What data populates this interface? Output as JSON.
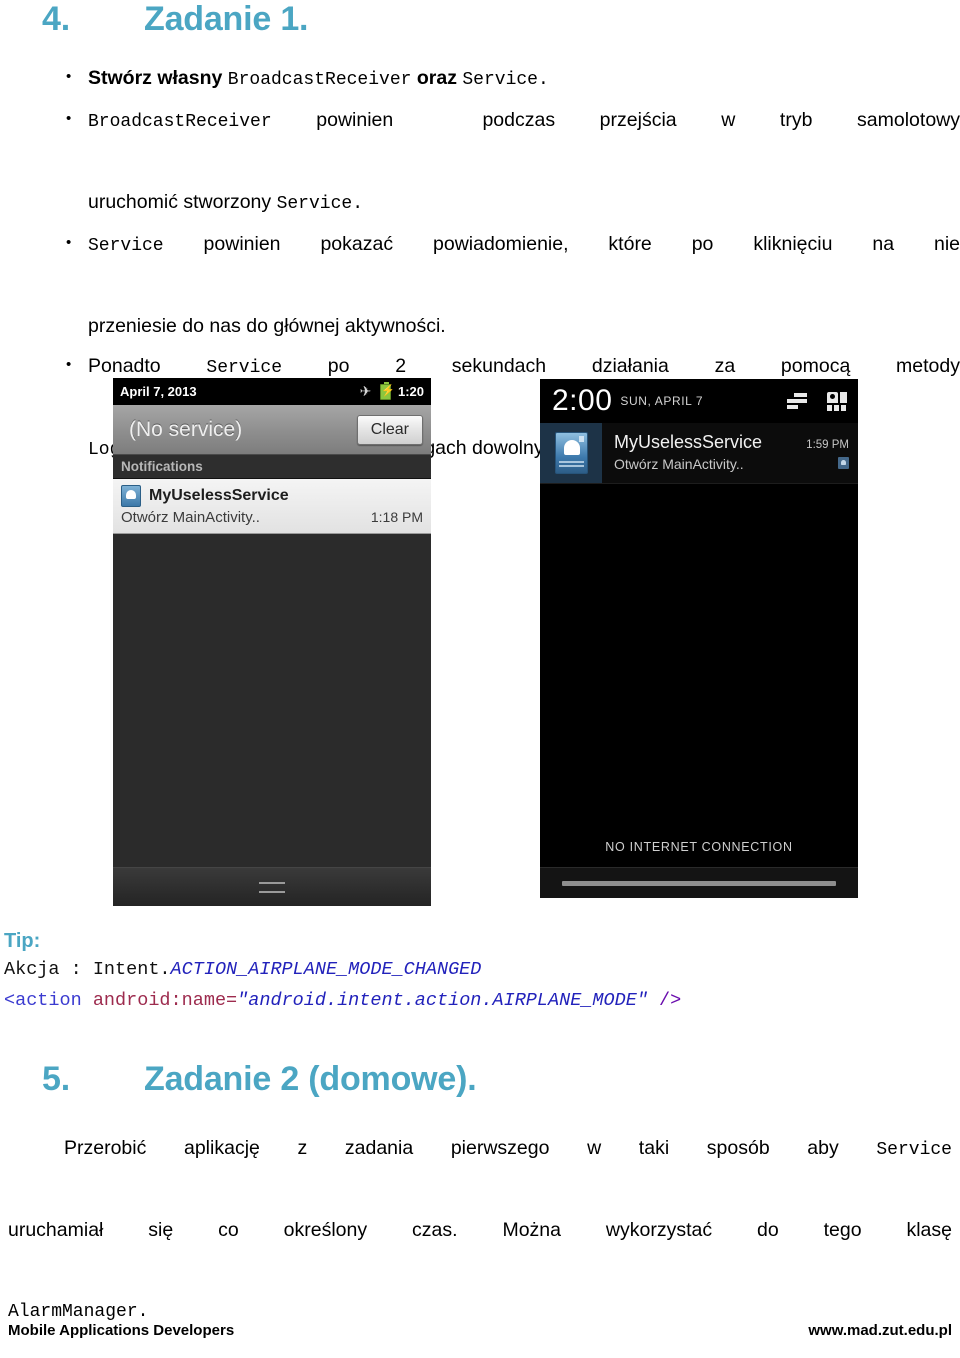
{
  "task1": {
    "number": "4.",
    "title": "Zadanie 1.",
    "bullets": [
      {
        "parts": [
          {
            "text": "Stwórz własny ",
            "style": "bold"
          },
          {
            "text": "BroadcastReceiver",
            "style": "mono"
          },
          {
            "text": " oraz ",
            "style": "bold"
          },
          {
            "text": "Service.",
            "style": "mono"
          }
        ]
      },
      {
        "parts": [
          {
            "text": "BroadcastReceiver",
            "style": "mono"
          },
          {
            "text": " powinien   podczas przejścia w tryb samolotowy uruchomić stworzony ",
            "style": "plain"
          },
          {
            "text": "Service.",
            "style": "mono"
          }
        ]
      },
      {
        "parts": [
          {
            "text": "Service",
            "style": "mono"
          },
          {
            "text": " powinien pokazać powiadomienie, które po kliknięciu na nie przeniesie do nas do głównej aktywności.",
            "style": "plain"
          }
        ]
      },
      {
        "parts": [
          {
            "text": "Ponadto ",
            "style": "plain"
          },
          {
            "text": "Service",
            "style": "mono"
          },
          {
            "text": " po 2 sekundach działania za pomocą metody ",
            "style": "plain"
          },
          {
            "text": "Log.d(String,String)",
            "style": "mono"
          },
          {
            "text": " wypisuję w logach dowolny tekst.",
            "style": "plain"
          }
        ]
      }
    ]
  },
  "screenshot_left": {
    "statusbar": {
      "date": "April 7, 2013",
      "airplane_icon": "airplane-mode-icon",
      "battery_icon": "battery-charging-icon",
      "time": "1:20"
    },
    "carrier_label": "(No service)",
    "clear_button": "Clear",
    "notifications_header": "Notifications",
    "notification": {
      "app_icon": "android-robot-icon",
      "title": "MyUselessService",
      "subtitle": "Otwórz MainActivity..",
      "timestamp": "1:18 PM"
    },
    "handle": "drag-handle"
  },
  "screenshot_right": {
    "statusbar": {
      "time": "2:00",
      "date": "SUN, APRIL 7",
      "clear_all_icon": "clear-all-icon",
      "quick_settings_icon": "quick-settings-icon"
    },
    "notification": {
      "app_icon": "android-robot-icon",
      "title": "MyUselessService",
      "subtitle": "Otwórz MainActivity..",
      "timestamp": "1:59 PM",
      "small_icon": "android-robot-mini-icon"
    },
    "status_message": "NO INTERNET CONNECTION",
    "handle": "drag-handle"
  },
  "tip": {
    "label": "Tip:",
    "line1": {
      "plain": "Akcja : Intent.",
      "constant": "ACTION_AIRPLANE_MODE_CHANGED"
    },
    "line2": {
      "tag_open": "<action",
      "attr": " android:name=",
      "value": "\"android.intent.action.AIRPLANE_MODE\"",
      "tag_close": " />"
    }
  },
  "task2": {
    "number": "5.",
    "title": "Zadanie 2 (domowe).",
    "paragraph": {
      "parts": [
        {
          "text": "Przerobić aplikację z zadania pierwszego w taki sposób aby ",
          "style": "plain"
        },
        {
          "text": "Service",
          "style": "mono"
        },
        {
          "text": " uruchamiał się co określony czas. Można wykorzystać do tego klasę ",
          "style": "plain"
        },
        {
          "text": "AlarmManager.",
          "style": "mono"
        }
      ]
    }
  },
  "footer": {
    "left": "Mobile Applications Developers",
    "right": "www.mad.zut.edu.pl"
  },
  "colors": {
    "accent": "#4BA6C3",
    "code_blue": "#2222BB",
    "code_attr": "#9D2B4E",
    "code_punct": "#6A0DAD"
  }
}
